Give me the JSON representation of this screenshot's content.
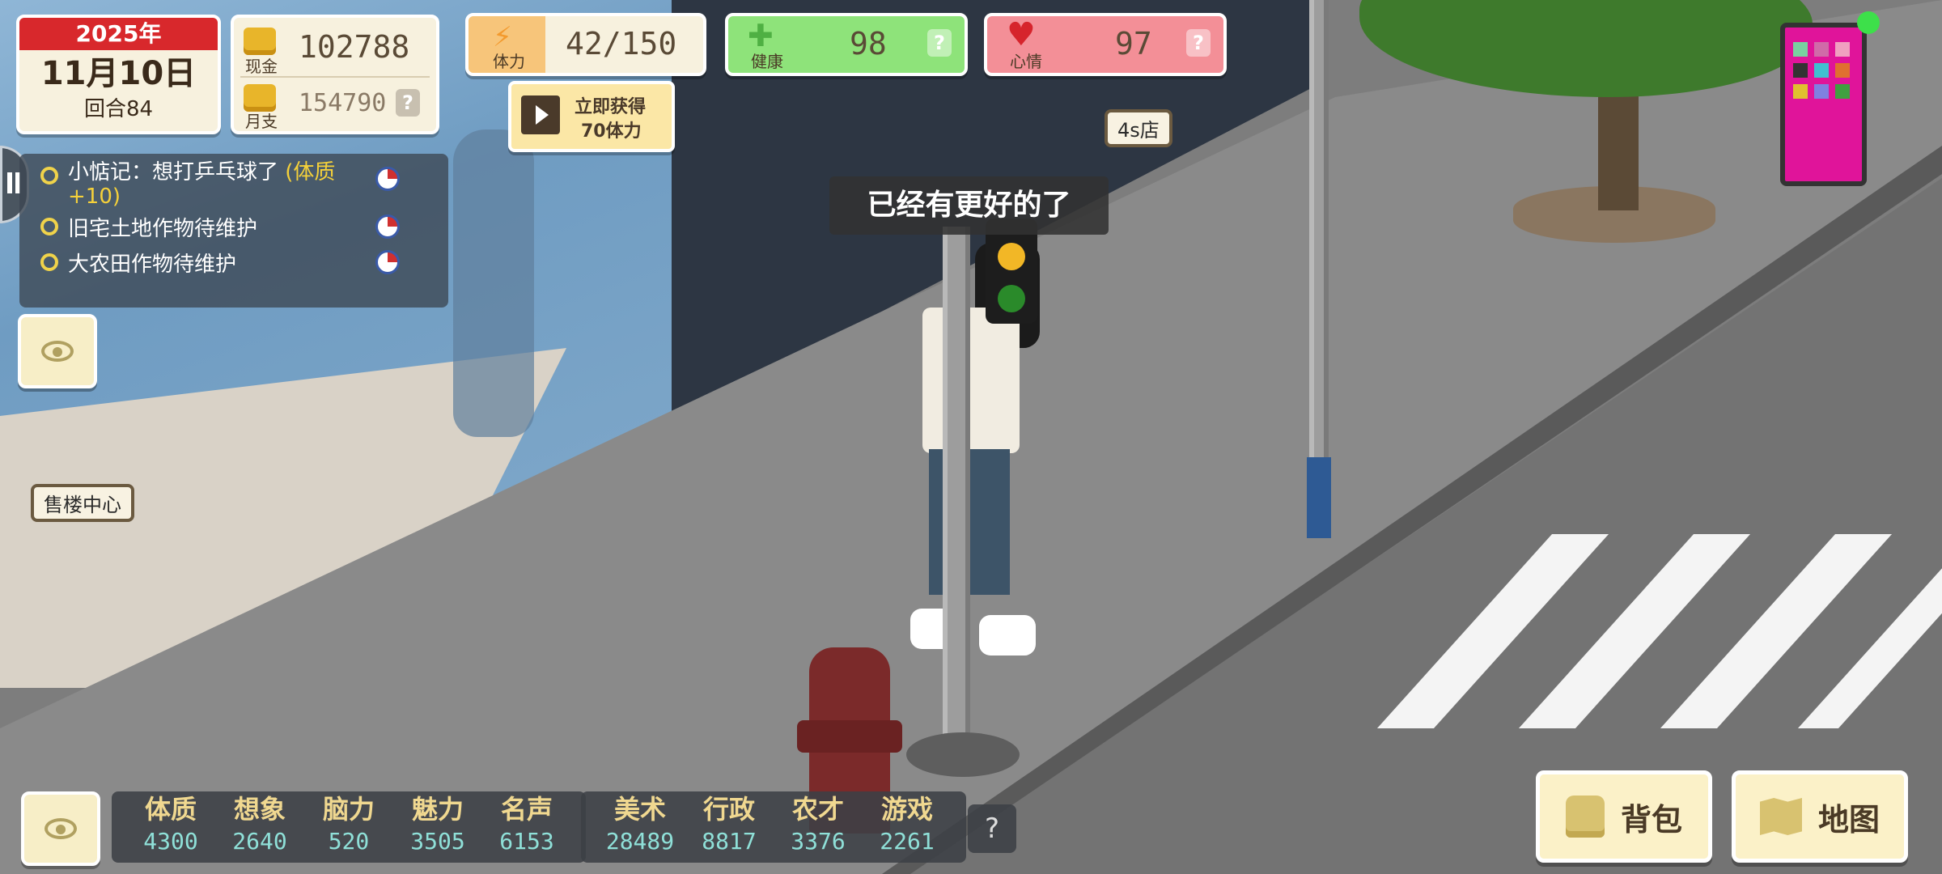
{
  "date_card": {
    "year": "2025年",
    "date": "11月10日",
    "turn": "回合84"
  },
  "cash": {
    "label": "现金",
    "value": "102788"
  },
  "monthly": {
    "label": "月支",
    "value": "154790",
    "help": "?"
  },
  "stamina": {
    "label": "体力",
    "value": "42/150"
  },
  "ad_offer": {
    "line1": "立即获得",
    "line2": "70体力"
  },
  "health": {
    "label": "健康",
    "value": "98",
    "help": "?"
  },
  "mood": {
    "label": "心情",
    "value": "97",
    "help": "?"
  },
  "tasks": [
    {
      "text": "小惦记：想打乒乓球了",
      "bonus": "(体质",
      "bonus2": "+10)"
    },
    {
      "text": "旧宅土地作物待维护"
    },
    {
      "text": "大农田作物待维护"
    }
  ],
  "speech_bubble": "已经有更好的了",
  "place_labels": {
    "shop": "4s店",
    "sales_center": "售楼中心"
  },
  "attributes_group1": [
    {
      "name": "体质",
      "value": "4300"
    },
    {
      "name": "想象",
      "value": "2640"
    },
    {
      "name": "脑力",
      "value": "520"
    },
    {
      "name": "魅力",
      "value": "3505"
    },
    {
      "name": "名声",
      "value": "6153"
    }
  ],
  "attributes_group2": [
    {
      "name": "美术",
      "value": "28489"
    },
    {
      "name": "行政",
      "value": "8817"
    },
    {
      "name": "农才",
      "value": "3376"
    },
    {
      "name": "游戏",
      "value": "2261"
    }
  ],
  "attributes_help": "?",
  "buttons": {
    "bag": "背包",
    "map": "地图"
  },
  "colors": {
    "health_bar": "#8ee37a",
    "mood_bar": "#f38f97",
    "stamina_icon": "#f39a2e",
    "year_banner": "#d8282c"
  }
}
